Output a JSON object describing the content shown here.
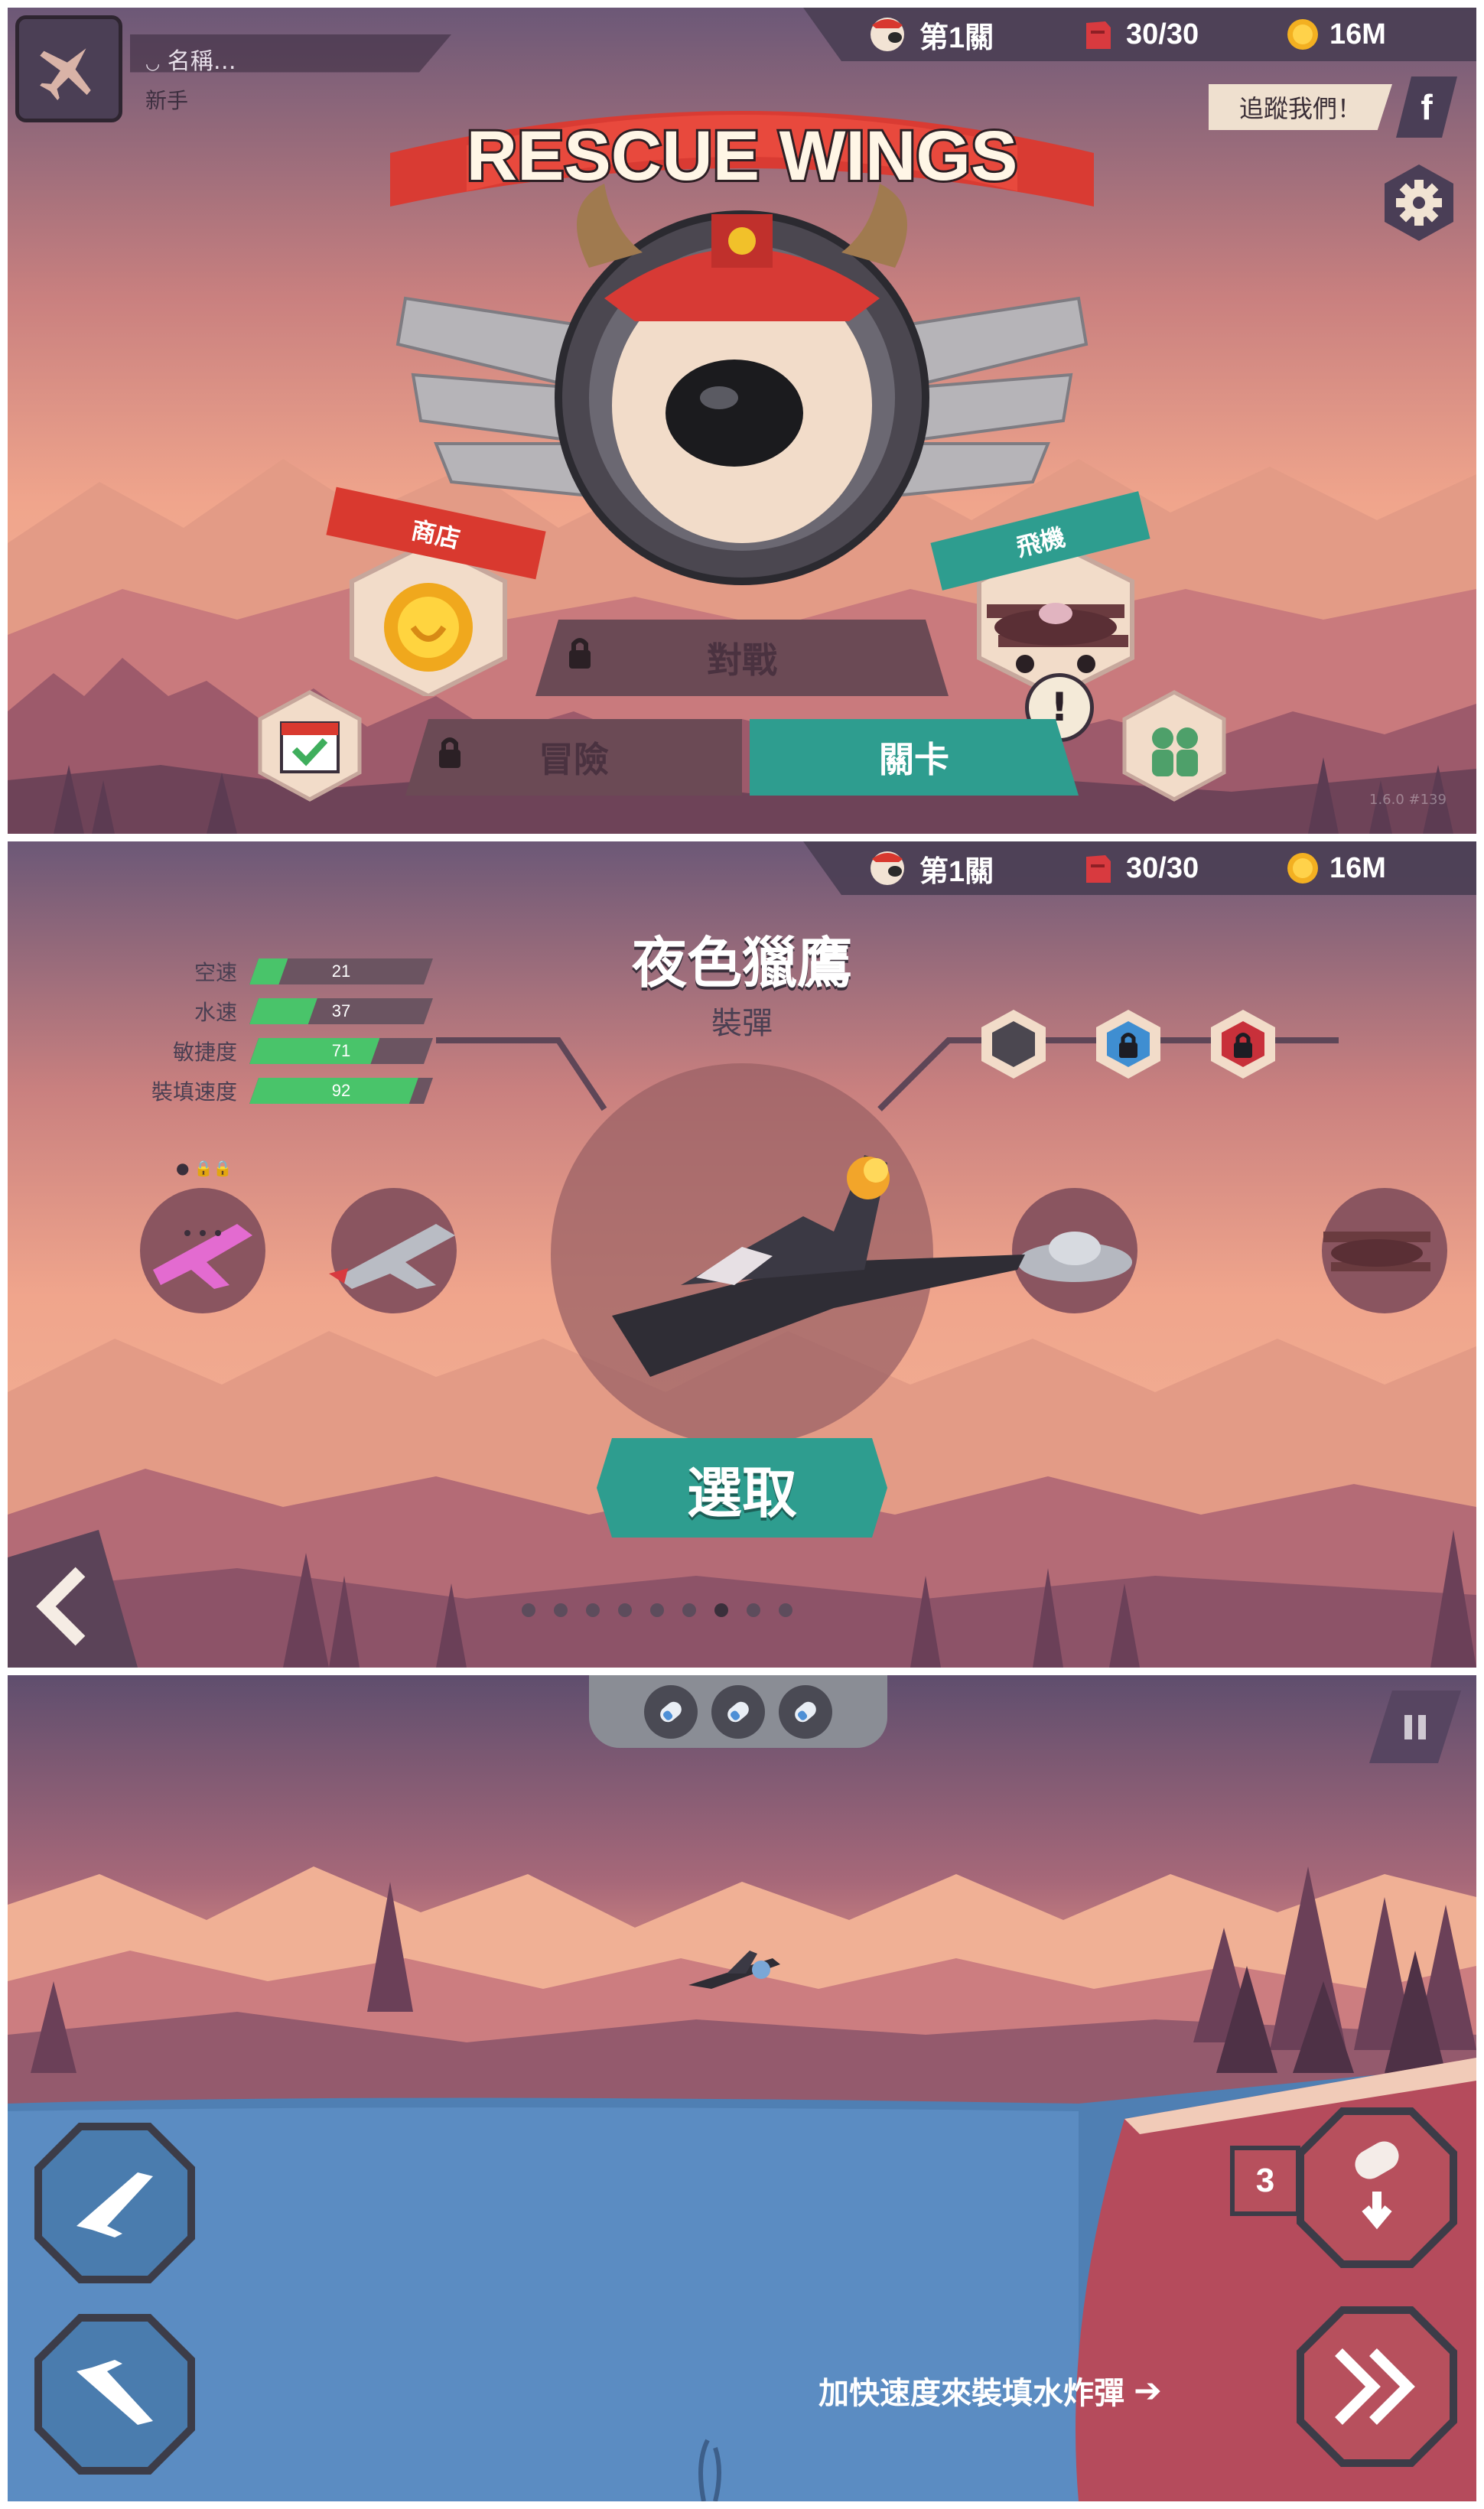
{
  "colors": {
    "sky_top": "#6c5877",
    "sky_mid": "#e0907f",
    "sky_low": "#f1b89a",
    "mountain_far": "#e39b86",
    "forest_mid": "#a05d6f",
    "forest_dark": "#5c3b52",
    "teal_button": "#2e9d8f",
    "locked_button": "#6b4a55",
    "hud_bg": "#4b3f55",
    "stat_green": "#49c46a",
    "water": "#4f7fb3",
    "cliff": "#b54b5c"
  },
  "hud": {
    "level_label": "第1關",
    "fuel_label": "30/30",
    "coins_label": "16M"
  },
  "screen1": {
    "player": {
      "name": "名稱…",
      "rank": "新手",
      "avatar_icon": "plane-silhouette-icon"
    },
    "logo_text": "RESCUE WINGS",
    "follow_label": "追蹤我們！",
    "facebook_icon": "facebook-icon",
    "settings_icon": "gear-icon",
    "shop_label": "商店",
    "planes_label": "飛機",
    "battle_label": "對戰",
    "adventure_label": "冒險",
    "levels_label": "關卡",
    "alert_label": "!",
    "version_label": "1.6.0 #139"
  },
  "screen2": {
    "plane_name": "夜色獵鷹",
    "plane_ability": "裝彈",
    "stats": [
      {
        "name": "空速",
        "value": 21
      },
      {
        "name": "水速",
        "value": 37
      },
      {
        "name": "敏捷度",
        "value": 71
      },
      {
        "name": "裝填速度",
        "value": 92
      }
    ],
    "upgrade_slots": [
      "empty-hex-icon",
      "blue-lock-icon",
      "red-lock-icon"
    ],
    "select_label": "選取",
    "back_icon": "chevron-left-icon",
    "page_count": 9,
    "active_page": 7
  },
  "screen3": {
    "water_bombs": 3,
    "ammo_count": "3",
    "hint_label": "加快速度來裝填水炸彈",
    "pause_icon": "pause-icon",
    "climb_icon": "plane-up-icon",
    "dive_icon": "plane-down-icon",
    "drop_icon": "bomb-drop-icon",
    "boost_icon": "double-chevron-icon"
  }
}
